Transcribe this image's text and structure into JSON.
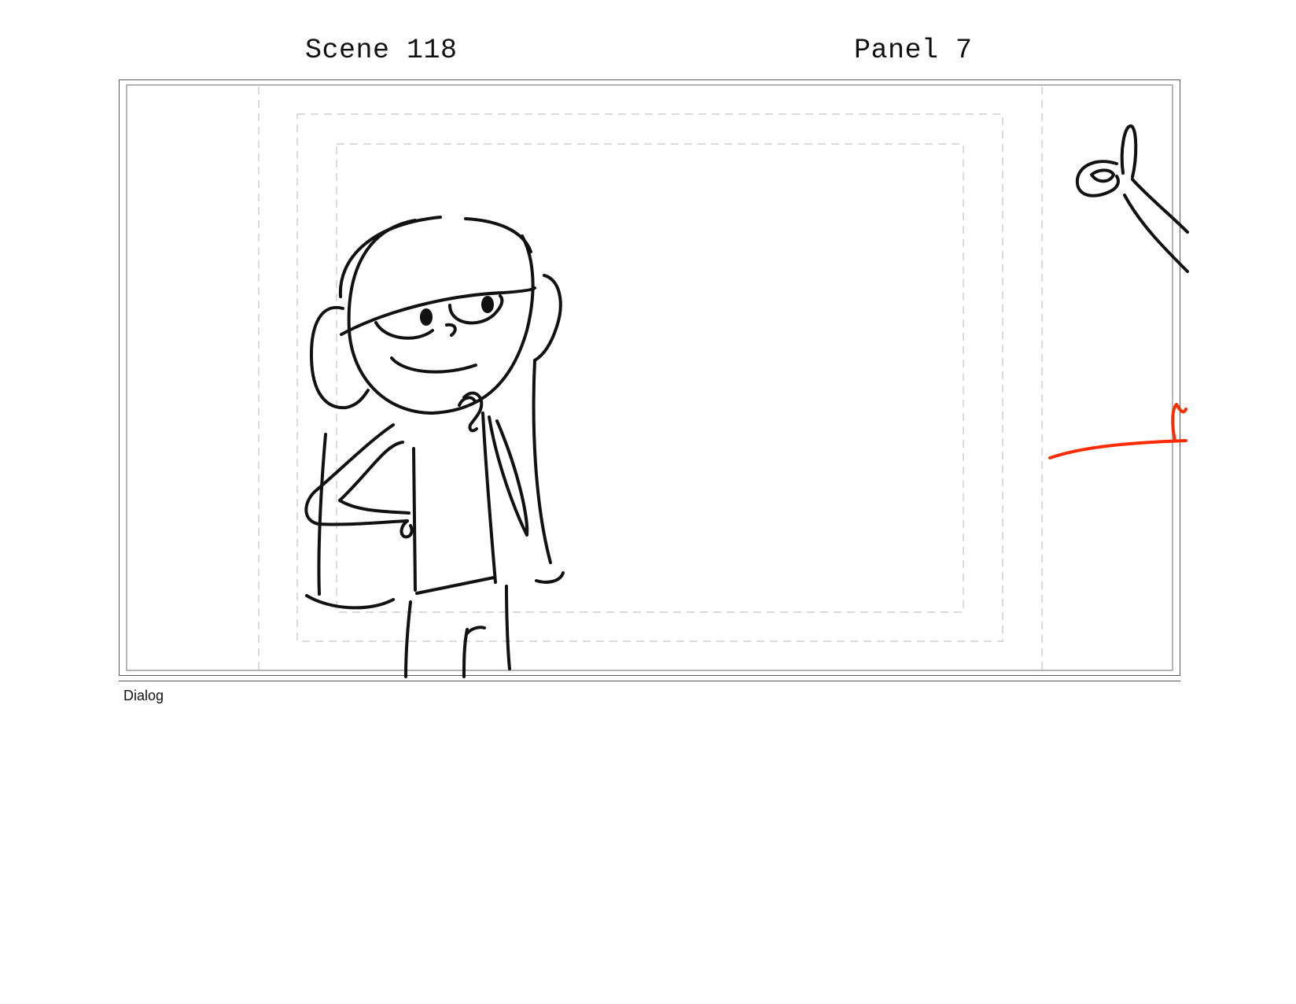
{
  "storyboard": {
    "scene_label": "Scene 118",
    "panel_label": "Panel 7",
    "dialog_label": "Dialog"
  },
  "colors": {
    "frame": "#555555",
    "inner_frame": "#b5b5b5",
    "guide_dash": "#c4c4c4",
    "sketch_ink": "#111111",
    "sketch_red": "#ff2a00"
  },
  "sketch": {
    "subjects": [
      "girl-character",
      "pointing-hand",
      "red-stroke"
    ]
  }
}
